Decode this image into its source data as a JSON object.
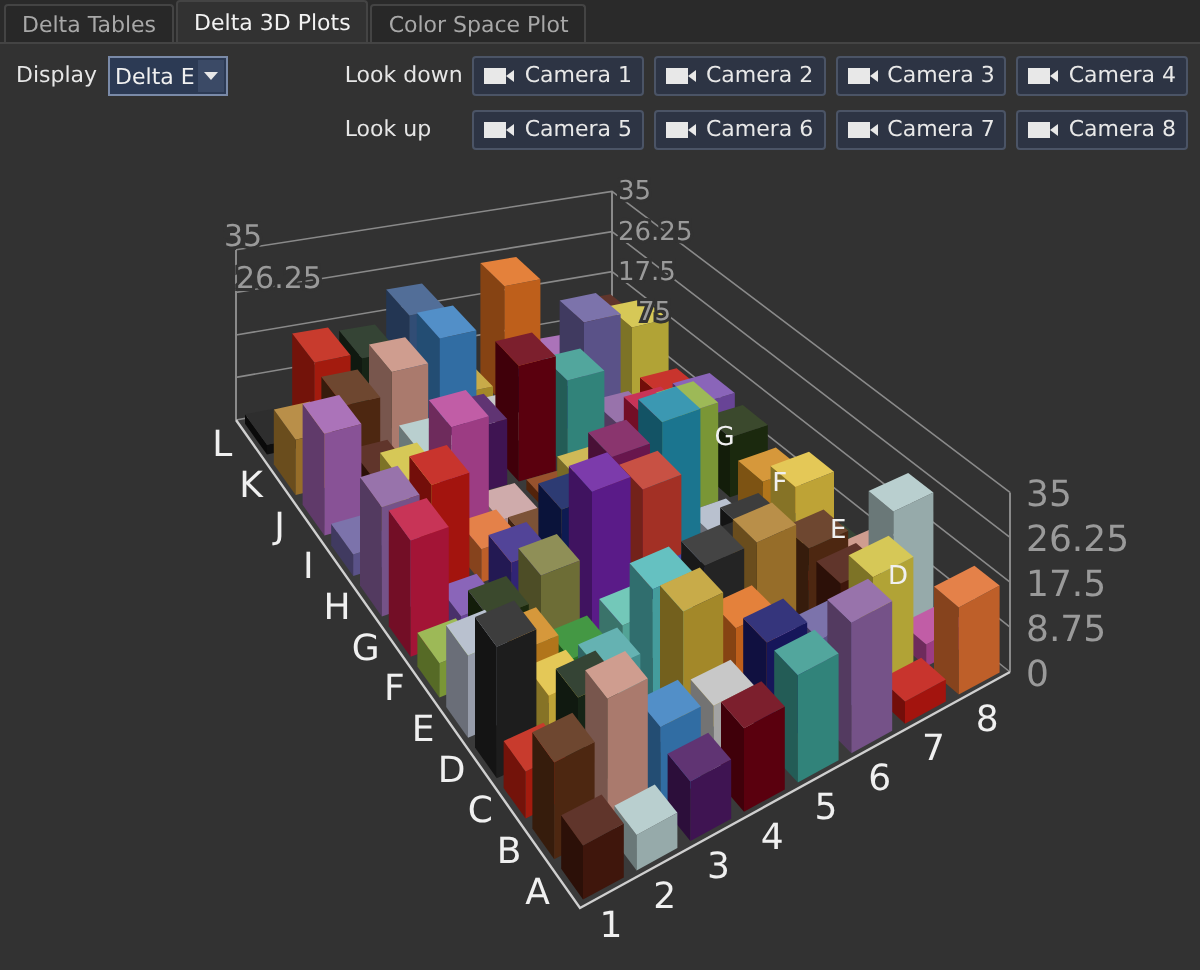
{
  "tabs": [
    {
      "label": "Delta Tables",
      "selected": false
    },
    {
      "label": "Delta 3D Plots",
      "selected": true
    },
    {
      "label": "Color Space Plot",
      "selected": false
    }
  ],
  "display": {
    "label": "Display",
    "value": "Delta E"
  },
  "camera_rows": [
    {
      "label": "Look down",
      "buttons": [
        "Camera 1",
        "Camera 2",
        "Camera 3",
        "Camera 4"
      ]
    },
    {
      "label": "Look up",
      "buttons": [
        "Camera 5",
        "Camera 6",
        "Camera 7",
        "Camera 8"
      ]
    }
  ],
  "plot": {
    "row_labels": [
      "A",
      "B",
      "C",
      "D",
      "E",
      "F",
      "G",
      "H",
      "I",
      "J",
      "K",
      "L"
    ],
    "column_labels": [
      "1",
      "2",
      "3",
      "4",
      "5",
      "6",
      "7",
      "8"
    ],
    "far_row_labels": [
      "G",
      "F",
      "E",
      "D"
    ],
    "left_ticks": [
      "35",
      "26.25"
    ],
    "back_ticks": [
      "35",
      "26.25",
      "17.5",
      "75"
    ],
    "right_ticks": [
      "35",
      "26.25",
      "17.5",
      "8.75",
      "0"
    ]
  }
}
